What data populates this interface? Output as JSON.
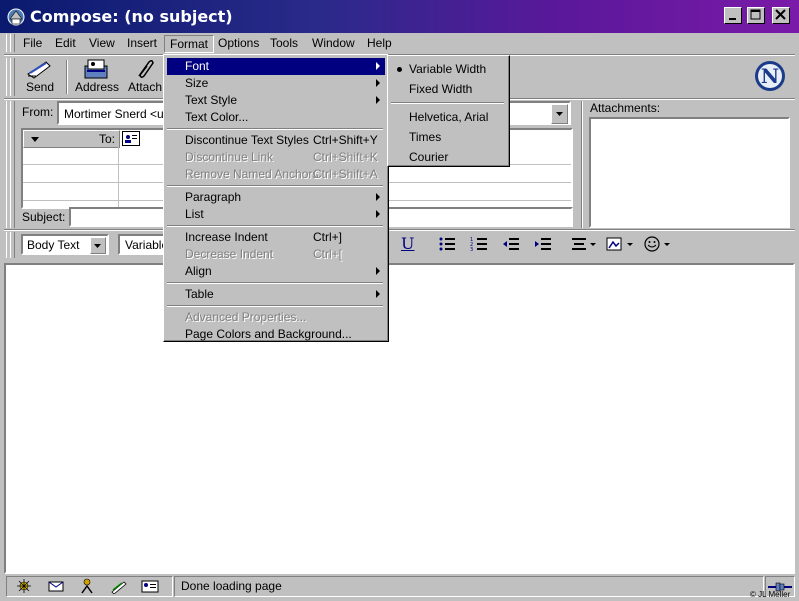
{
  "window": {
    "title": "Compose: (no subject)"
  },
  "menubar": {
    "items": [
      "File",
      "Edit",
      "View",
      "Insert",
      "Format",
      "Options",
      "Tools",
      "Window",
      "Help"
    ]
  },
  "toolbar": {
    "send_label": "Send",
    "address_label": "Address",
    "attach_label": "Attach"
  },
  "header": {
    "from_label": "From:",
    "from_value": "Mortimer Snerd <use",
    "to_label": "To:",
    "subject_label": "Subject:",
    "attachments_label": "Attachments:"
  },
  "format_toolbar": {
    "paragraph_style": "Body Text",
    "font": "Variable"
  },
  "format_menu": {
    "items": [
      {
        "label": "Font",
        "shortcut": "",
        "submenu": true,
        "disabled": false,
        "selected": true
      },
      {
        "label": "Size",
        "shortcut": "",
        "submenu": true,
        "disabled": false
      },
      {
        "label": "Text Style",
        "shortcut": "",
        "submenu": true,
        "disabled": false
      },
      {
        "label": "Text Color...",
        "shortcut": "",
        "submenu": false,
        "disabled": false
      },
      {
        "separator": true
      },
      {
        "label": "Discontinue Text Styles",
        "shortcut": "Ctrl+Shift+Y",
        "submenu": false,
        "disabled": false
      },
      {
        "label": "Discontinue Link",
        "shortcut": "Ctrl+Shift+K",
        "submenu": false,
        "disabled": true
      },
      {
        "label": "Remove Named Anchors",
        "shortcut": "Ctrl+Shift+A",
        "submenu": false,
        "disabled": true
      },
      {
        "separator": true
      },
      {
        "label": "Paragraph",
        "shortcut": "",
        "submenu": true,
        "disabled": false
      },
      {
        "label": "List",
        "shortcut": "",
        "submenu": true,
        "disabled": false
      },
      {
        "separator": true
      },
      {
        "label": "Increase Indent",
        "shortcut": "Ctrl+]",
        "submenu": false,
        "disabled": false
      },
      {
        "label": "Decrease Indent",
        "shortcut": "Ctrl+[",
        "submenu": false,
        "disabled": true
      },
      {
        "label": "Align",
        "shortcut": "",
        "submenu": true,
        "disabled": false
      },
      {
        "separator": true
      },
      {
        "label": "Table",
        "shortcut": "",
        "submenu": true,
        "disabled": false
      },
      {
        "separator": true
      },
      {
        "label": "Advanced Properties...",
        "shortcut": "",
        "submenu": false,
        "disabled": true
      },
      {
        "label": "Page Colors and Background...",
        "shortcut": "",
        "submenu": false,
        "disabled": false
      }
    ]
  },
  "font_submenu": {
    "items": [
      {
        "label": "Variable Width",
        "checked": true
      },
      {
        "label": "Fixed Width",
        "checked": false
      },
      {
        "separator": true
      },
      {
        "label": "Helvetica, Arial",
        "checked": false
      },
      {
        "label": "Times",
        "checked": false
      },
      {
        "label": "Courier",
        "checked": false
      }
    ]
  },
  "status": {
    "text": "Done loading page",
    "credit": "© JL Meller"
  },
  "colors": {
    "title_start": "#0a1a6e",
    "title_end": "#7a1aa8",
    "menu_highlight": "#000080",
    "face": "#c0c0c0"
  }
}
